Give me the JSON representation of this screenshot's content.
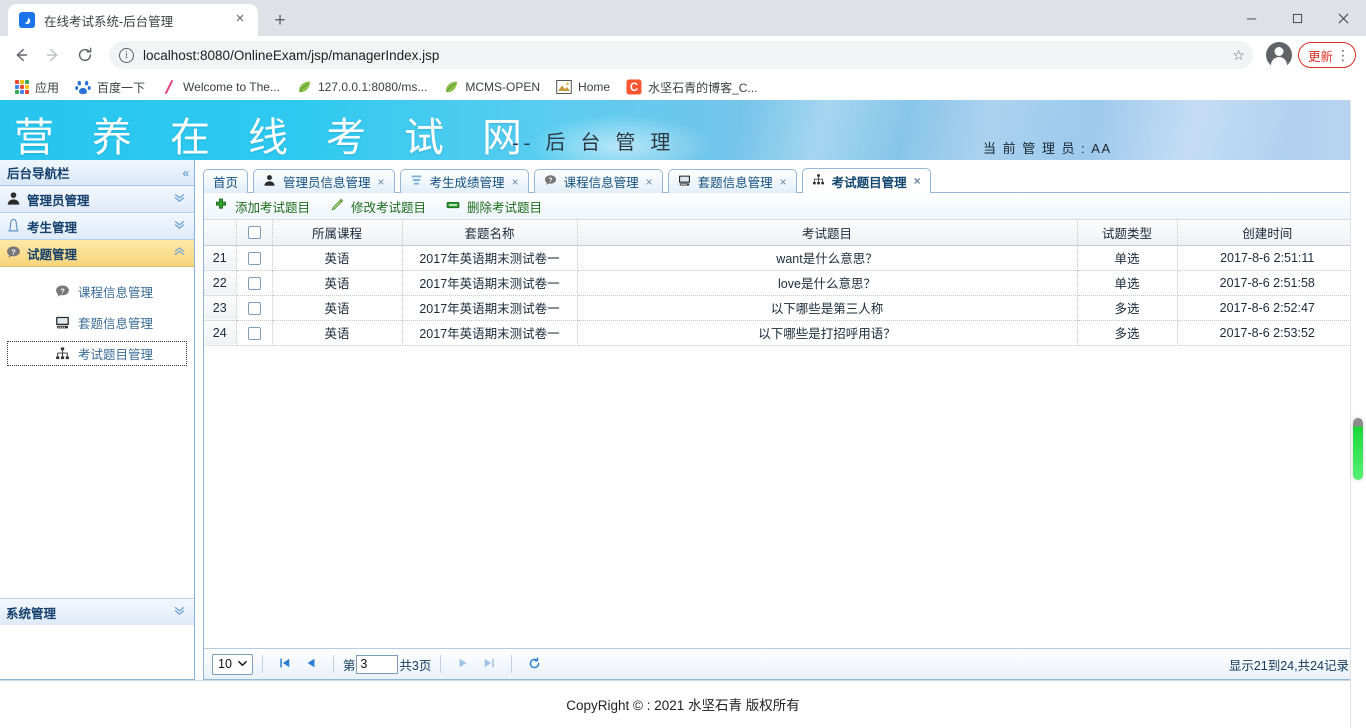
{
  "browser": {
    "tab": {
      "title": "在线考试系统-后台管理",
      "favicon": "browser-favicon",
      "close": "×"
    },
    "new_tab": "+",
    "window_controls": {
      "minimize": "—",
      "maximize": "❐",
      "close": "✕"
    },
    "nav": {
      "back": "←",
      "forward": "→",
      "reload": "⟳"
    },
    "omnibox": {
      "info_icon": "i",
      "url": "localhost:8080/OnlineExam/jsp/managerIndex.jsp",
      "star": "☆"
    },
    "update_button": {
      "label": "更新",
      "menu": "⋮"
    },
    "bookmarks": [
      {
        "label": "应用",
        "icon": "apps-grid-icon"
      },
      {
        "label": "百度一下",
        "icon": "baidu-icon"
      },
      {
        "label": "Welcome to The...",
        "icon": "slash-icon"
      },
      {
        "label": "127.0.0.1:8080/ms...",
        "icon": "leaf-icon"
      },
      {
        "label": "MCMS-OPEN",
        "icon": "leaf-icon"
      },
      {
        "label": "Home",
        "icon": "picture-icon"
      },
      {
        "label": "水坚石青的博客_C...",
        "icon": "csdn-icon"
      }
    ]
  },
  "banner": {
    "title": "营 养 在 线 考 试 网",
    "subtitle": "-- 后 台 管 理",
    "current_user": "当 前 管 理 员 : AA"
  },
  "sidebar": {
    "header": {
      "label": "后台导航栏",
      "collapse_icon": "«"
    },
    "items": [
      {
        "label": "管理员管理",
        "icon": "user-icon",
        "chevron": "⌄",
        "active": false
      },
      {
        "label": "考生管理",
        "icon": "group-icon",
        "chevron": "⌄",
        "active": false
      },
      {
        "label": "试题管理",
        "icon": "question-icon",
        "chevron": "⌃",
        "active": true
      }
    ],
    "subitems": [
      {
        "label": "课程信息管理",
        "icon": "question-icon",
        "selected": false
      },
      {
        "label": "套题信息管理",
        "icon": "monitor-icon",
        "selected": false
      },
      {
        "label": "考试题目管理",
        "icon": "sitemap-icon",
        "selected": true
      }
    ],
    "footer": {
      "label": "系统管理",
      "chevron": "⌄"
    }
  },
  "tabs": [
    {
      "label": "首页",
      "icon": null,
      "closable": false,
      "active": false
    },
    {
      "label": "管理员信息管理",
      "icon": "user-icon",
      "closable": true,
      "active": false,
      "close": "×"
    },
    {
      "label": "考生成绩管理",
      "icon": "chart-icon",
      "closable": true,
      "active": false,
      "close": "×"
    },
    {
      "label": "课程信息管理",
      "icon": "question-icon",
      "closable": true,
      "active": false,
      "close": "×"
    },
    {
      "label": "套题信息管理",
      "icon": "monitor-icon",
      "closable": true,
      "active": false,
      "close": "×"
    },
    {
      "label": "考试题目管理",
      "icon": "sitemap-icon",
      "closable": true,
      "active": true,
      "close": "×"
    }
  ],
  "toolbar": [
    {
      "label": "添加考试题目",
      "icon": "add-icon"
    },
    {
      "label": "修改考试题目",
      "icon": "edit-icon"
    },
    {
      "label": "删除考试题目",
      "icon": "delete-icon"
    }
  ],
  "table": {
    "columns": [
      "",
      "",
      "所属课程",
      "套题名称",
      "考试题目",
      "试题类型",
      "创建时间"
    ],
    "select_all": "checkbox",
    "rows": [
      {
        "index": "21",
        "checked": false,
        "course": "英语",
        "paper": "2017年英语期末测试卷一",
        "question": "want是什么意思？",
        "type": "单选",
        "created": "2017-8-6   2:51:11"
      },
      {
        "index": "22",
        "checked": false,
        "course": "英语",
        "paper": "2017年英语期末测试卷一",
        "question": "love是什么意思？",
        "type": "单选",
        "created": "2017-8-6   2:51:58"
      },
      {
        "index": "23",
        "checked": false,
        "course": "英语",
        "paper": "2017年英语期末测试卷一",
        "question": "以下哪些是第三人称",
        "type": "多选",
        "created": "2017-8-6   2:52:47"
      },
      {
        "index": "24",
        "checked": false,
        "course": "英语",
        "paper": "2017年英语期末测试卷一",
        "question": "以下哪些是打招呼用语？",
        "type": "多选",
        "created": "2017-8-6   2:53:52"
      }
    ]
  },
  "pager": {
    "page_size": "10",
    "page_size_caret": "⌄",
    "first": "⏮",
    "prev": "◀",
    "page_label_prefix": "第",
    "page_value": "3",
    "page_total_label": "共3页",
    "next": "▶",
    "last": "⏭",
    "refresh": "↻",
    "summary": "显示21到24,共24记录"
  },
  "footer": {
    "copyright": "CopyRight © : 2021 水坚石青 版权所有"
  },
  "colors": {
    "banner_start": "#27c6ef",
    "banner_end": "#b9d4f0",
    "accent_blue": "#15527f",
    "active_sidebar": "#f7d47a",
    "toolbar_green": "#1d6b1d",
    "update_red": "#d93025",
    "scroll_thumb_green": "#19d63a"
  }
}
